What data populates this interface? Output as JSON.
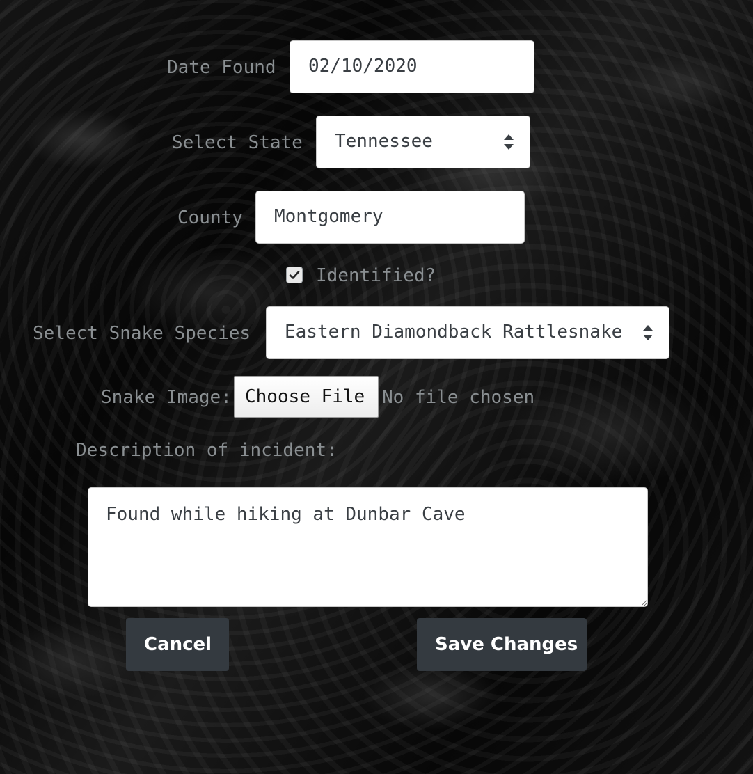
{
  "form": {
    "date_found": {
      "label": "Date Found",
      "value": "02/10/2020"
    },
    "state": {
      "label": "Select State",
      "selected": "Tennessee"
    },
    "county": {
      "label": "County",
      "value": "Montgomery"
    },
    "identified": {
      "label": "Identified?",
      "checked": true
    },
    "species": {
      "label": "Select Snake Species",
      "selected": "Eastern Diamondback Rattlesnake"
    },
    "image": {
      "label": "Snake Image:",
      "button_label": "Choose File",
      "status": "No file chosen"
    },
    "description": {
      "label": "Description of incident:",
      "value": "Found while hiking at Dunbar Cave"
    }
  },
  "actions": {
    "cancel_label": "Cancel",
    "save_label": "Save Changes"
  },
  "colors": {
    "button_bg": "#343a40",
    "label_text": "#8a8f92"
  }
}
